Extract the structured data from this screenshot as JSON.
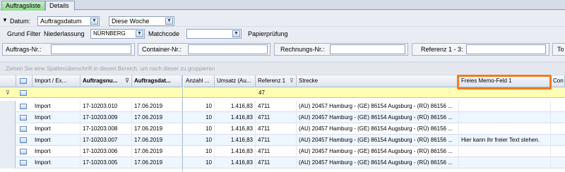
{
  "tabs": [
    {
      "label": "Auftragsliste",
      "active": true
    },
    {
      "label": "Details",
      "active": false
    }
  ],
  "filter1": {
    "datum_label": "Datum:",
    "datum_value": "Auftragsdatum",
    "range_value": "Diese Woche"
  },
  "filter2": {
    "grund_label": "Grund Filter",
    "niederlassung_label": "Niederlassung",
    "niederlassung_value": "NÜRNBERG",
    "matchcode_label": "Matchcode",
    "matchcode_value": "",
    "papier_label": "Papierprüfung"
  },
  "filter3": {
    "auftrags_label": "Auftrags-Nr.:",
    "container_label": "Container-Nr.:",
    "rechnungs_label": "Rechnungs-Nr.:",
    "referenz_label": "Referenz 1 - 3:",
    "to_label": "To"
  },
  "groupbar_text": "Ziehen Sie eine Spaltenüberschrift in diesen Bereich, um nach dieser zu gruppieren",
  "grid": {
    "headers": [
      "Import / Ex...",
      "Auftragsnu...",
      "Auftragsdat...",
      "Anzahl ...",
      "Umsatz (Au...",
      "Referenz 1",
      "Strecke",
      "Freies Memo-Feld 1",
      "Con"
    ],
    "filter_referenz": "47",
    "rows": [
      {
        "type": "Import",
        "nr": "17-10203.010",
        "datum": "17.06.2019",
        "anzahl": "10",
        "umsatz": "1.416,83",
        "ref": "4711",
        "strecke": "(AU) 20457 Hamburg - (GE) 86154 Augsburg - (RÜ) 86156 ...",
        "memo": ""
      },
      {
        "type": "Import",
        "nr": "17-10203.009",
        "datum": "17.06.2019",
        "anzahl": "10",
        "umsatz": "1.416,83",
        "ref": "4711",
        "strecke": "(AU) 20457 Hamburg - (GE) 86154 Augsburg - (RÜ) 86156 ...",
        "memo": ""
      },
      {
        "type": "Import",
        "nr": "17-10203.008",
        "datum": "17.06.2019",
        "anzahl": "10",
        "umsatz": "1.416,83",
        "ref": "4711",
        "strecke": "(AU) 20457 Hamburg - (GE) 86154 Augsburg - (RÜ) 86156 ...",
        "memo": ""
      },
      {
        "type": "Import",
        "nr": "17-10203.007",
        "datum": "17.06.2019",
        "anzahl": "10",
        "umsatz": "1.416,83",
        "ref": "4711",
        "strecke": "(AU) 20457 Hamburg - (GE) 86154 Augsburg - (RÜ) 86156 ...",
        "memo": "Hier kann ihr freier Text stehen."
      },
      {
        "type": "Import",
        "nr": "17-10203.006",
        "datum": "17.06.2019",
        "anzahl": "10",
        "umsatz": "1.416,83",
        "ref": "4711",
        "strecke": "(AU) 20457 Hamburg - (GE) 86154 Augsburg - (RÜ) 86156 ...",
        "memo": ""
      },
      {
        "type": "Import",
        "nr": "17-10203.005",
        "datum": "17.06.2019",
        "anzahl": "10",
        "umsatz": "1.416,83",
        "ref": "4711",
        "strecke": "(AU) 20457 Hamburg - (GE) 86154 Augsburg - (RÜ) 86156 ...",
        "memo": ""
      }
    ]
  },
  "colors": {
    "highlight": "#f07b1e",
    "active_tab": "#8fd88f",
    "filter_row": "#ffffb3"
  }
}
